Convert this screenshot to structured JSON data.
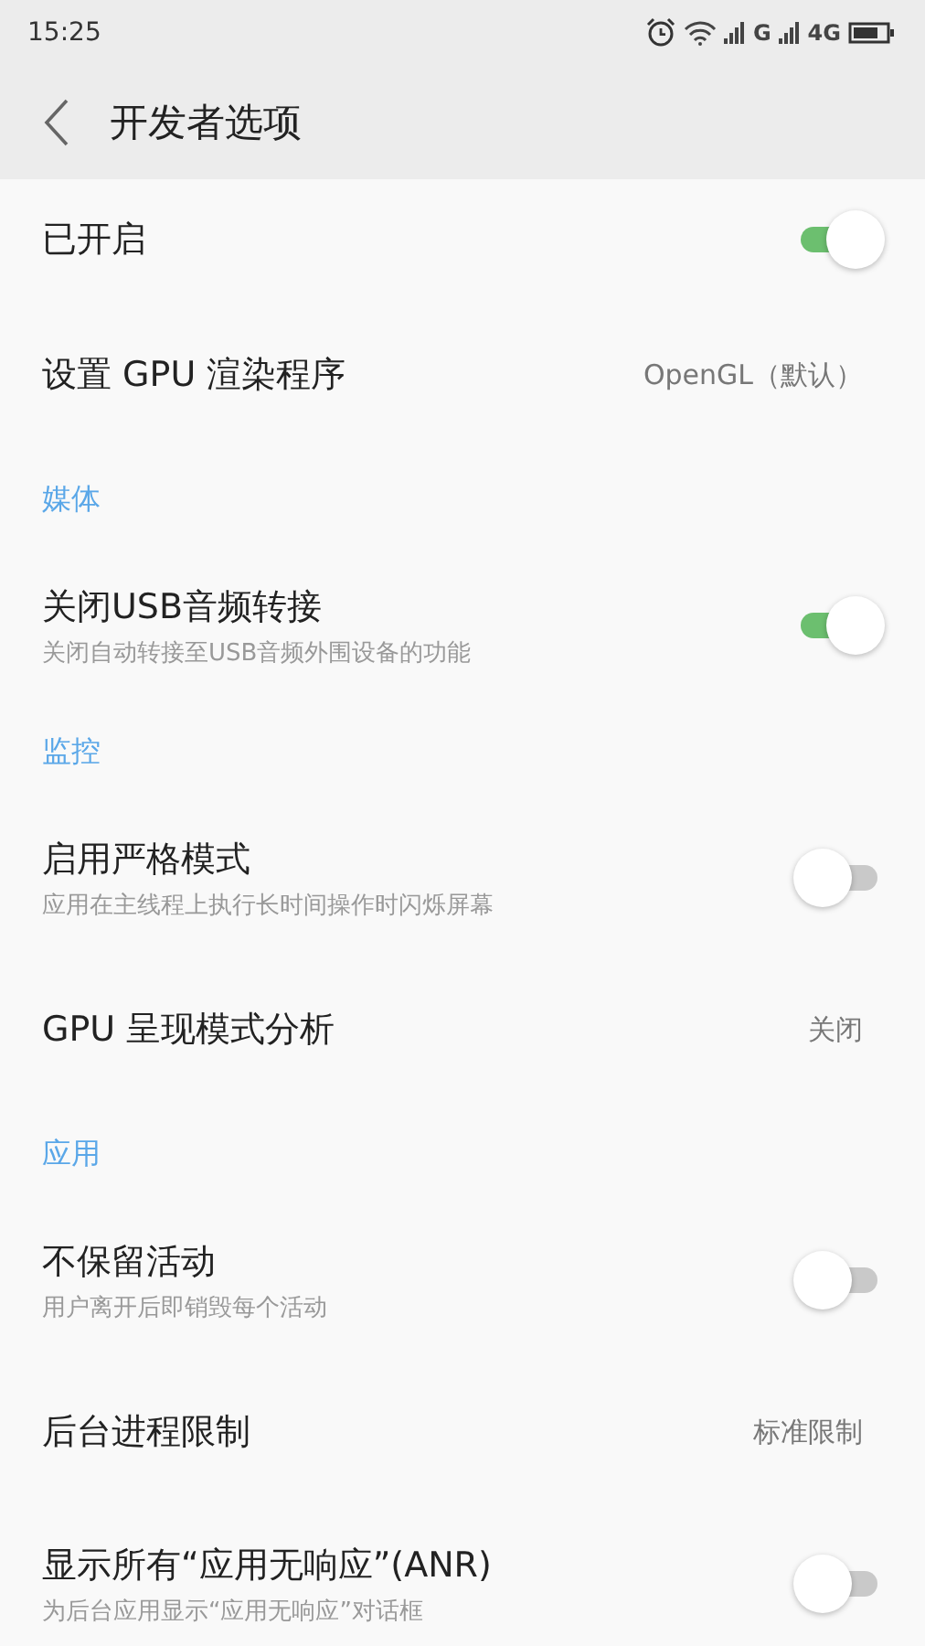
{
  "status_bar": {
    "time": "15:25",
    "network_1": "G",
    "network_2": "4G"
  },
  "header": {
    "title": "开发者选项"
  },
  "items": [
    {
      "kind": "toggle",
      "title": "已开启",
      "on": true
    },
    {
      "kind": "value",
      "title": "设置 GPU 渲染程序",
      "value": "OpenGL（默认）"
    },
    {
      "kind": "section",
      "title": "媒体"
    },
    {
      "kind": "toggle",
      "title": "关闭USB音频转接",
      "subtitle": "关闭自动转接至USB音频外围设备的功能",
      "on": true
    },
    {
      "kind": "section",
      "title": "监控"
    },
    {
      "kind": "toggle",
      "title": "启用严格模式",
      "subtitle": "应用在主线程上执行长时间操作时闪烁屏幕",
      "on": false
    },
    {
      "kind": "value",
      "title": "GPU 呈现模式分析",
      "value": "关闭"
    },
    {
      "kind": "section",
      "title": "应用"
    },
    {
      "kind": "toggle",
      "title": "不保留活动",
      "subtitle": "用户离开后即销毁每个活动",
      "on": false
    },
    {
      "kind": "value",
      "title": "后台进程限制",
      "value": "标准限制"
    },
    {
      "kind": "toggle",
      "title": "显示所有“应用无响应”(ANR)",
      "subtitle": "为后台应用显示“应用无响应”对话框",
      "on": false
    }
  ]
}
